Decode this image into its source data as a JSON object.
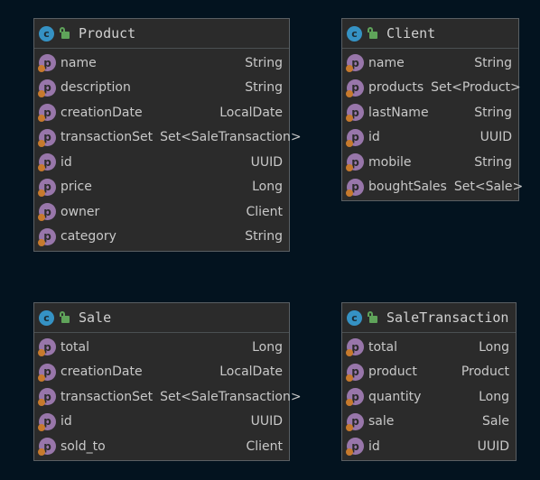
{
  "classes": [
    {
      "name": "Product",
      "fields": [
        {
          "name": "name",
          "type": "String"
        },
        {
          "name": "description",
          "type": "String"
        },
        {
          "name": "creationDate",
          "type": "LocalDate"
        },
        {
          "name": "transactionSet",
          "type": "Set<SaleTransaction>"
        },
        {
          "name": "id",
          "type": "UUID"
        },
        {
          "name": "price",
          "type": "Long"
        },
        {
          "name": "owner",
          "type": "Client"
        },
        {
          "name": "category",
          "type": "String"
        }
      ]
    },
    {
      "name": "Client",
      "fields": [
        {
          "name": "name",
          "type": "String"
        },
        {
          "name": "products",
          "type": "Set<Product>"
        },
        {
          "name": "lastName",
          "type": "String"
        },
        {
          "name": "id",
          "type": "UUID"
        },
        {
          "name": "mobile",
          "type": "String"
        },
        {
          "name": "boughtSales",
          "type": "Set<Sale>"
        }
      ]
    },
    {
      "name": "Sale",
      "fields": [
        {
          "name": "total",
          "type": "Long"
        },
        {
          "name": "creationDate",
          "type": "LocalDate"
        },
        {
          "name": "transactionSet",
          "type": "Set<SaleTransaction>"
        },
        {
          "name": "id",
          "type": "UUID"
        },
        {
          "name": "sold_to",
          "type": "Client"
        }
      ]
    },
    {
      "name": "SaleTransaction",
      "fields": [
        {
          "name": "total",
          "type": "Long"
        },
        {
          "name": "product",
          "type": "Product"
        },
        {
          "name": "quantity",
          "type": "Long"
        },
        {
          "name": "sale",
          "type": "Sale"
        },
        {
          "name": "id",
          "type": "UUID"
        }
      ]
    }
  ],
  "icons": {
    "class_letter": "c",
    "field_letter": "p",
    "class_icon": "class-icon",
    "visibility_icon": "public-lock-icon",
    "field_icon": "property-icon"
  },
  "colors": {
    "background": "#03131f",
    "box": "#2b2b2b",
    "class_icon": "#3592c4",
    "property_icon": "#9876aa",
    "lock": "#5fa35a"
  }
}
